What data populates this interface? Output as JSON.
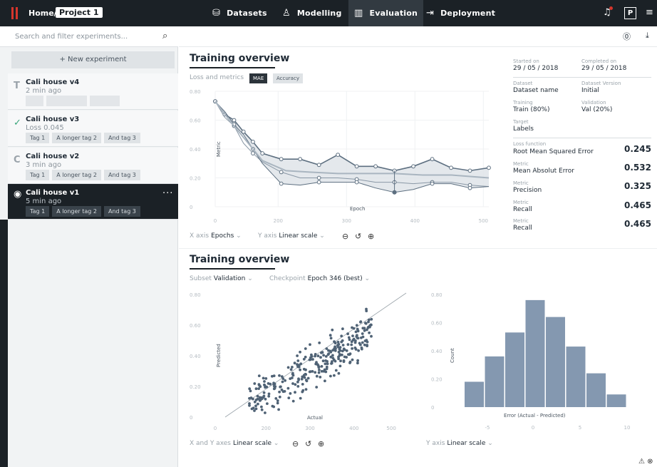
{
  "header": {
    "home": "Home/",
    "project": "Project 1",
    "nav": [
      {
        "label": "Datasets",
        "icon": "database-icon"
      },
      {
        "label": "Modelling",
        "icon": "hierarchy-icon"
      },
      {
        "label": "Evaluation",
        "icon": "bar-chart-icon"
      },
      {
        "label": "Deployment",
        "icon": "export-icon"
      }
    ],
    "profile": "P"
  },
  "sidebar": {
    "search_placeholder": "Search and filter experiments...",
    "new_experiment": "+ New experiment",
    "experiments": [
      {
        "letter": "T",
        "name": "Cali house v4",
        "sub": "2 min ago",
        "tags": []
      },
      {
        "letter": "✓",
        "name": "Cali house v3",
        "sub": "Loss 0.045",
        "tags": [
          "Tag 1",
          "A longer tag 2",
          "And tag 3"
        ]
      },
      {
        "letter": "C",
        "name": "Cali house v2",
        "sub": "3 min ago",
        "tags": [
          "Tag 1",
          "A longer tag 2",
          "And tag 3"
        ]
      },
      {
        "letter": "◉",
        "name": "Cali house v1",
        "sub": "5 min ago",
        "tags": [
          "Tag 1",
          "A longer tag 2",
          "And tag 3"
        ]
      }
    ]
  },
  "overview": {
    "title": "Training overview",
    "loss_label": "Loss and metrics",
    "pill_mae": "MAE",
    "pill_acc": "Accuracy",
    "x_axis_label": "X axis",
    "x_axis_value": "Epochs",
    "y_axis_label": "Y axis",
    "y_axis_value": "Linear scale"
  },
  "meta": {
    "started_k": "Started on",
    "started_v": "29 / 05 / 2018",
    "completed_k": "Completed on",
    "completed_v": "29 / 05 / 2018",
    "dataset_k": "Dataset",
    "dataset_v": "Dataset name",
    "version_k": "Dataset Version",
    "version_v": "Initial",
    "training_k": "Training",
    "training_v": "Train (80%)",
    "validation_k": "Validation",
    "validation_v": "Val (20%)",
    "target_k": "Target",
    "target_v": "Labels",
    "metrics": [
      {
        "k": "Loss function",
        "v": "Root Mean Squared Error",
        "n": "0.245"
      },
      {
        "k": "Metric",
        "v": "Mean Absolut Error",
        "n": "0.532"
      },
      {
        "k": "Metric",
        "v": "Precision",
        "n": "0.325"
      },
      {
        "k": "Metric",
        "v": "Recall",
        "n": "0.465"
      },
      {
        "k": "Metric",
        "v": "Recall",
        "n": "0.465"
      }
    ]
  },
  "overview2": {
    "title": "Training overview",
    "subset_label": "Subset",
    "subset_value": "Validation",
    "checkpoint_label": "Checkpoint",
    "checkpoint_value": "Epoch 346 (best)",
    "xy_label": "X and Y axes",
    "xy_value": "Linear scale",
    "y2_label": "Y axis",
    "y2_value": "Linear scale"
  },
  "chart_data": [
    {
      "type": "line",
      "xlabel": "Epoch",
      "ylabel": "Metric",
      "xlim": [
        0,
        500
      ],
      "ylim": [
        0,
        0.8
      ],
      "xticks": [
        "0",
        "200",
        "300",
        "400",
        "500"
      ],
      "yticks": [
        "0",
        "0.20",
        "0.40",
        "0.60",
        "0.80"
      ],
      "series": [
        {
          "values": [
            [
              0,
              0.73
            ],
            [
              20,
              0.64
            ],
            [
              40,
              0.6
            ],
            [
              60,
              0.52
            ],
            [
              80,
              0.45
            ],
            [
              100,
              0.37
            ],
            [
              140,
              0.33
            ],
            [
              180,
              0.33
            ],
            [
              220,
              0.29
            ],
            [
              260,
              0.36
            ],
            [
              300,
              0.28
            ],
            [
              340,
              0.28
            ],
            [
              380,
              0.25
            ],
            [
              420,
              0.28
            ],
            [
              460,
              0.33
            ],
            [
              500,
              0.27
            ],
            [
              540,
              0.25
            ],
            [
              580,
              0.27
            ]
          ]
        },
        {
          "values": [
            [
              0,
              0.73
            ],
            [
              20,
              0.62
            ],
            [
              40,
              0.56
            ],
            [
              60,
              0.44
            ],
            [
              80,
              0.37
            ],
            [
              100,
              0.31
            ],
            [
              140,
              0.24
            ],
            [
              180,
              0.2
            ],
            [
              220,
              0.2
            ],
            [
              260,
              0.2
            ],
            [
              300,
              0.19
            ],
            [
              340,
              0.17
            ],
            [
              380,
              0.17
            ],
            [
              420,
              0.16
            ],
            [
              460,
              0.17
            ],
            [
              500,
              0.17
            ],
            [
              540,
              0.15
            ],
            [
              580,
              0.14
            ]
          ]
        },
        {
          "values": [
            [
              0,
              0.73
            ],
            [
              20,
              0.66
            ],
            [
              40,
              0.57
            ],
            [
              60,
              0.5
            ],
            [
              80,
              0.4
            ],
            [
              100,
              0.3
            ],
            [
              140,
              0.16
            ],
            [
              180,
              0.15
            ],
            [
              220,
              0.17
            ],
            [
              260,
              0.17
            ],
            [
              300,
              0.17
            ],
            [
              340,
              0.13
            ],
            [
              380,
              0.1
            ],
            [
              420,
              0.12
            ],
            [
              460,
              0.16
            ],
            [
              500,
              0.16
            ],
            [
              540,
              0.13
            ],
            [
              580,
              0.14
            ]
          ]
        },
        {
          "values": [
            [
              0,
              0.73
            ],
            [
              30,
              0.6
            ],
            [
              60,
              0.48
            ],
            [
              100,
              0.32
            ],
            [
              150,
              0.25
            ],
            [
              200,
              0.24
            ],
            [
              260,
              0.23
            ],
            [
              320,
              0.23
            ],
            [
              380,
              0.23
            ],
            [
              440,
              0.22
            ],
            [
              500,
              0.22
            ],
            [
              580,
              0.2
            ]
          ]
        }
      ]
    },
    {
      "type": "scatter",
      "xlabel": "Actual",
      "ylabel": "Predicted",
      "xlim": [
        100,
        500
      ],
      "ylim": [
        0,
        0.8
      ],
      "xticks": [
        "0",
        "200",
        "300",
        "400",
        "500"
      ],
      "yticks": [
        "0",
        "0.20",
        "0.40",
        "0.60",
        "0.80"
      ],
      "n_points": 300
    },
    {
      "type": "bar",
      "xlabel": "Error (Actual - Predicted)",
      "ylabel": "Count",
      "ylim": [
        0,
        0.8
      ],
      "xticks": [
        "-5",
        "0",
        "5",
        "10"
      ],
      "yticks": [
        "0",
        "0.20",
        "0.40",
        "0.60",
        "0.80"
      ],
      "values": [
        0.18,
        0.36,
        0.53,
        0.76,
        0.64,
        0.43,
        0.24,
        0.09
      ]
    }
  ]
}
